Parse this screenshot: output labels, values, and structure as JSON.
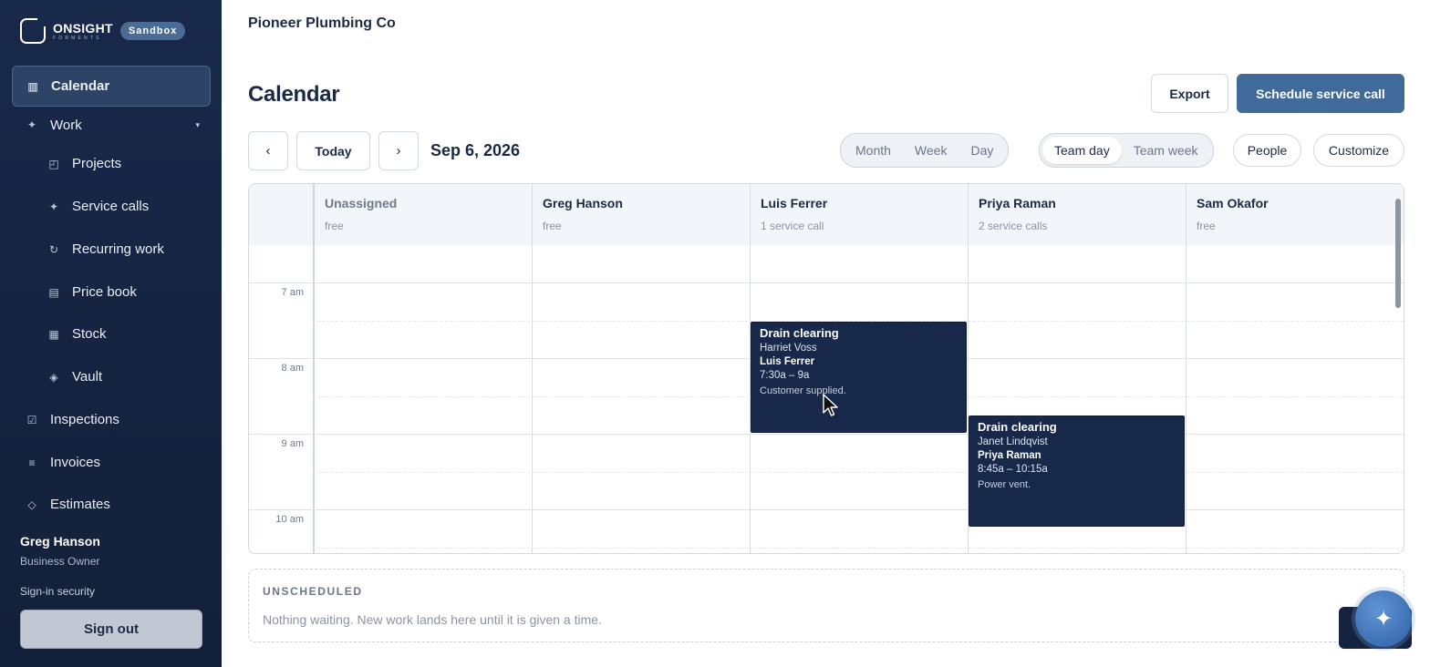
{
  "brand": {
    "name": "ONSIGHT",
    "sub": "FORMENTS",
    "badge": "Sandbox"
  },
  "sidebar": {
    "items": [
      {
        "label": "Calendar",
        "icon": "calendar-grid-icon",
        "active": true
      },
      {
        "label": "Work",
        "icon": "sparkle-icon"
      },
      {
        "label": "Projects",
        "icon": "projects-icon"
      },
      {
        "label": "Service calls",
        "icon": "sparkle-icon"
      },
      {
        "label": "Recurring work",
        "icon": "recurring-icon"
      },
      {
        "label": "Price book",
        "icon": "list-icon"
      },
      {
        "label": "Stock",
        "icon": "grid-icon"
      },
      {
        "label": "Vault",
        "icon": "diamond-icon"
      },
      {
        "label": "Inspections",
        "icon": "checkbox-icon"
      },
      {
        "label": "Invoices",
        "icon": "lines-icon"
      },
      {
        "label": "Estimates",
        "icon": "diamond-outline-icon"
      }
    ],
    "user": {
      "name": "Greg Hanson",
      "role": "Business Owner"
    },
    "signin_security": "Sign-in security",
    "signout": "Sign out"
  },
  "header": {
    "company": "Pioneer Plumbing Co",
    "title": "Calendar",
    "export": "Export",
    "schedule": "Schedule service call"
  },
  "toolbar": {
    "prev": "‹",
    "today": "Today",
    "next": "›",
    "date": "Sep 6, 2026",
    "views": [
      "Month",
      "Week",
      "Day"
    ],
    "team_views": [
      "Team day",
      "Team week"
    ],
    "team_selected": "Team day",
    "people": "People",
    "customize": "Customize"
  },
  "calendar": {
    "columns": [
      {
        "name": "Unassigned",
        "status": "free"
      },
      {
        "name": "Greg Hanson",
        "status": "free"
      },
      {
        "name": "Luis Ferrer",
        "status": "1 service call"
      },
      {
        "name": "Priya Raman",
        "status": "2 service calls"
      },
      {
        "name": "Sam Okafor",
        "status": "free"
      }
    ],
    "hours": [
      "7 am",
      "8 am",
      "9 am",
      "10 am"
    ],
    "events": [
      {
        "title": "Drain clearing",
        "customer": "Harriet Voss",
        "worker": "Luis Ferrer",
        "time": "7:30a – 9a",
        "note": "Customer supplied."
      },
      {
        "title": "Drain clearing",
        "customer": "Janet Lindqvist",
        "worker": "Priya Raman",
        "time": "8:45a – 10:15a",
        "note": "Power vent."
      }
    ]
  },
  "unscheduled": {
    "title": "UNSCHEDULED",
    "message": "Nothing waiting. New work lands here until it is given a time."
  },
  "colors": {
    "sidebar": "#19294a",
    "primary": "#3f6a99",
    "event": "#17284a"
  }
}
